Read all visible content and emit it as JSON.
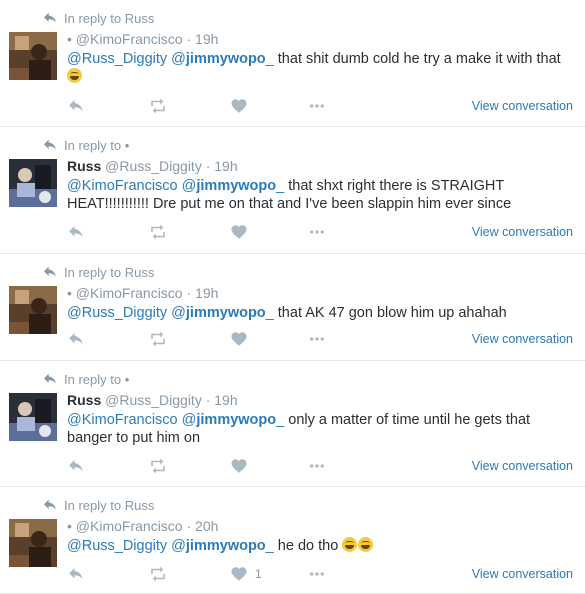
{
  "colors": {
    "link": "#2b7bb9",
    "muted": "#8899a6",
    "icon": "#aab8c2",
    "text": "#292f33",
    "divider": "#e1e8ed"
  },
  "tweets": [
    {
      "context": "In reply to Russ",
      "name": "",
      "handle": "@KimoFrancisco",
      "time": "19h",
      "mention1": "@Russ_Diggity",
      "mention2_prefix": "@",
      "mention2_bold": "jimmywopo",
      "mention2_suffix": "_",
      "text": "that shit dumb cold he try a make it with that",
      "emoji": [
        "face-with-tears-of-joy"
      ],
      "likes": "",
      "view": "View conversation",
      "avatar": "kimo-avatar"
    },
    {
      "context": "In reply to •",
      "name": "Russ",
      "handle": "@Russ_Diggity",
      "time": "19h",
      "mention1": "@KimoFrancisco",
      "mention2_prefix": "@",
      "mention2_bold": "jimmywopo",
      "mention2_suffix": "_",
      "text": "that shxt right there is STRAIGHT HEAT!!!!!!!!!!! Dre put me on that and I've been slappin him ever since",
      "emoji": [],
      "likes": "",
      "view": "View conversation",
      "avatar": "russ-avatar"
    },
    {
      "context": "In reply to Russ",
      "name": "",
      "handle": "@KimoFrancisco",
      "time": "19h",
      "mention1": "@Russ_Diggity",
      "mention2_prefix": "@",
      "mention2_bold": "jimmywopo",
      "mention2_suffix": "_",
      "text": "that AK 47 gon blow him up ahahah",
      "emoji": [],
      "likes": "",
      "view": "View conversation",
      "avatar": "kimo-avatar"
    },
    {
      "context": "In reply to •",
      "name": "Russ",
      "handle": "@Russ_Diggity",
      "time": "19h",
      "mention1": "@KimoFrancisco",
      "mention2_prefix": "@",
      "mention2_bold": "jimmywopo",
      "mention2_suffix": "_",
      "text": "only a matter of time until he gets that banger to put him on",
      "emoji": [],
      "likes": "",
      "view": "View conversation",
      "avatar": "russ-avatar"
    },
    {
      "context": "In reply to Russ",
      "name": "",
      "handle": "@KimoFrancisco",
      "time": "20h",
      "mention1": "@Russ_Diggity",
      "mention2_prefix": "@",
      "mention2_bold": "jimmywopo",
      "mention2_suffix": "_",
      "text": "he do tho",
      "emoji": [
        "face-with-tears-of-joy",
        "face-with-tears-of-joy"
      ],
      "likes": "1",
      "view": "View conversation",
      "avatar": "kimo-avatar"
    }
  ]
}
